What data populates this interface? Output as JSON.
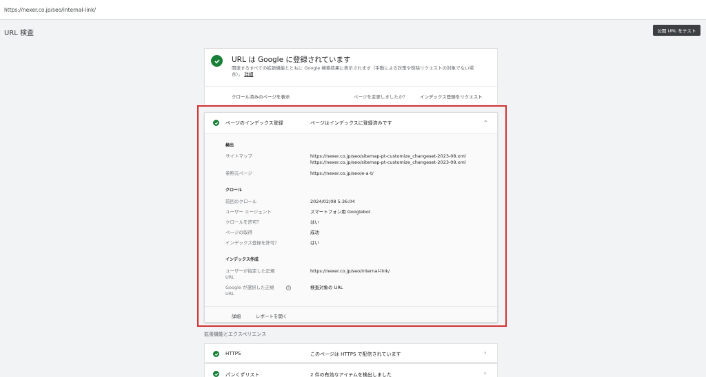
{
  "browser": {
    "url": "https://nexer.co.jp/seo/internal-link/"
  },
  "header": {
    "title": "URL 検査",
    "test_button": "公開 URL をテスト"
  },
  "summary": {
    "title": "URL は Google に登録されています",
    "description": "関連するすべての拡張機能とともに Google 検索結果に表示されます（手動による対策や削除リクエストの対象でない場合）。",
    "detail_link": "詳細",
    "view_crawled": "クロール済みのページを表示",
    "changed_question": "ページを変更しましたか？",
    "request_indexing": "インデックス登録をリクエスト"
  },
  "coverage": {
    "label": "ページのインデックス登録",
    "status": "ページはインデックスに登録済みです",
    "discovery": {
      "heading": "検出",
      "sitemap_label": "サイトマップ",
      "sitemaps": [
        "https://nexer.co.jp/seo/sitemap-pt-customize_changeset-2023-08.xml",
        "https://nexer.co.jp/seo/sitemap-pt-customize_changeset-2023-09.xml"
      ],
      "referring_label": "参照元ページ",
      "referring_value": "https://nexer.co.jp/seo/e-a-t/"
    },
    "crawl": {
      "heading": "クロール",
      "last_crawl_label": "前回のクロール",
      "last_crawl_value": "2024/02/08 5:36:04",
      "user_agent_label": "ユーザー エージェント",
      "user_agent_value": "スマートフォン用 Googlebot",
      "crawl_allowed_label": "クロールを許可？",
      "crawl_allowed_value": "はい",
      "fetch_label": "ページの取得",
      "fetch_value": "成功",
      "index_allowed_label": "インデックス登録を許可？",
      "index_allowed_value": "はい"
    },
    "indexing": {
      "heading": "インデックス作成",
      "user_canonical_label_1": "ユーザーが指定した正規",
      "user_canonical_label_2": "URL",
      "user_canonical_value": "https://nexer.co.jp/seo/internal-link/",
      "google_canonical_label_1": "Google が選択した正規",
      "google_canonical_label_2": "URL",
      "google_canonical_value": "検査対象の URL"
    },
    "footer": {
      "details": "詳細",
      "open_report": "レポートを開く"
    }
  },
  "enhancements": {
    "title": "拡張機能とエクスペリエンス",
    "items": [
      {
        "label": "HTTPS",
        "status": "このページは HTTPS で配信されています"
      },
      {
        "label": "パンくずリスト",
        "status": "2 件の有効なアイテムを検出しました"
      }
    ]
  },
  "colors": {
    "success": "#188038",
    "highlight": "#d32f2f",
    "dark_button": "#3c4043"
  }
}
